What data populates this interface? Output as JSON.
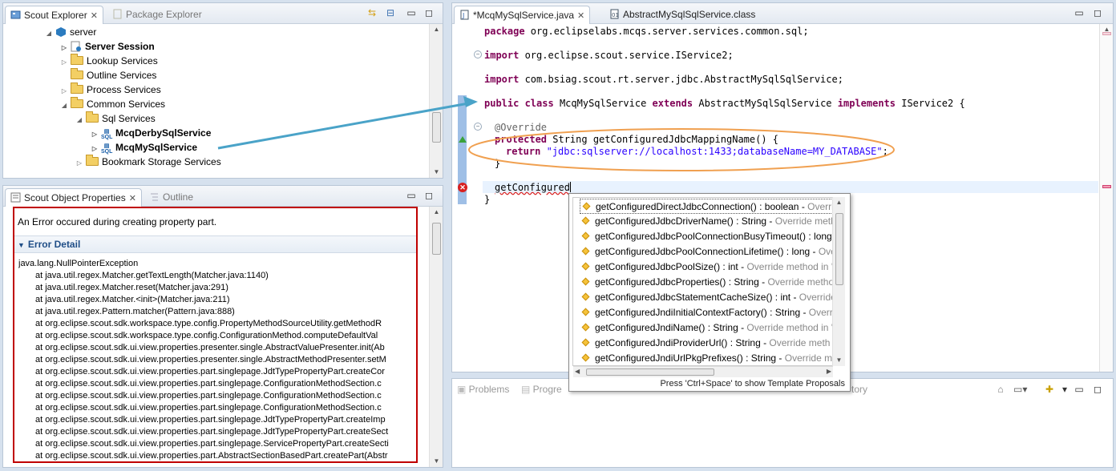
{
  "scout_explorer": {
    "tabs": [
      {
        "label": "Scout Explorer"
      },
      {
        "label": "Package Explorer"
      }
    ],
    "tree": [
      {
        "label": "server",
        "bold": false
      },
      {
        "label": "Server Session",
        "bold": true
      },
      {
        "label": "Lookup Services",
        "bold": false
      },
      {
        "label": "Outline Services",
        "bold": false
      },
      {
        "label": "Process Services",
        "bold": false
      },
      {
        "label": "Common Services",
        "bold": false
      },
      {
        "label": "Sql Services",
        "bold": false
      },
      {
        "label": "McqDerbySqlService",
        "bold": true
      },
      {
        "label": "McqMySqlService",
        "bold": true
      },
      {
        "label": "Bookmark Storage Services",
        "bold": false
      }
    ]
  },
  "properties": {
    "tabs": [
      {
        "label": "Scout Object Properties"
      },
      {
        "label": "Outline"
      }
    ],
    "error_message": "An Error occured during creating property part.",
    "section_title": "Error Detail",
    "stack": [
      "java.lang.NullPointerException",
      "at java.util.regex.Matcher.getTextLength(Matcher.java:1140)",
      "at java.util.regex.Matcher.reset(Matcher.java:291)",
      "at java.util.regex.Matcher.<init>(Matcher.java:211)",
      "at java.util.regex.Pattern.matcher(Pattern.java:888)",
      "at org.eclipse.scout.sdk.workspace.type.config.PropertyMethodSourceUtility.getMethodR",
      "at org.eclipse.scout.sdk.workspace.type.config.ConfigurationMethod.computeDefaultVal",
      "at org.eclipse.scout.sdk.ui.view.properties.presenter.single.AbstractValuePresenter.init(Ab",
      "at org.eclipse.scout.sdk.ui.view.properties.presenter.single.AbstractMethodPresenter.setM",
      "at org.eclipse.scout.sdk.ui.view.properties.part.singlepage.JdtTypePropertyPart.createCor",
      "at org.eclipse.scout.sdk.ui.view.properties.part.singlepage.ConfigurationMethodSection.c",
      "at org.eclipse.scout.sdk.ui.view.properties.part.singlepage.ConfigurationMethodSection.c",
      "at org.eclipse.scout.sdk.ui.view.properties.part.singlepage.ConfigurationMethodSection.c",
      "at org.eclipse.scout.sdk.ui.view.properties.part.singlepage.JdtTypePropertyPart.createImp",
      "at org.eclipse.scout.sdk.ui.view.properties.part.singlepage.JdtTypePropertyPart.createSect",
      "at org.eclipse.scout.sdk.ui.view.properties.part.singlepage.ServicePropertyPart.createSecti",
      "at org.eclipse.scout.sdk.ui.view.properties.part.AbstractSectionBasedPart.createPart(Abstr"
    ]
  },
  "editor": {
    "tabs": [
      {
        "label": "*McqMySqlService.java"
      },
      {
        "label": "AbstractMySqlSqlService.class"
      }
    ],
    "code": {
      "package_kw": "package",
      "package_rest": " org.eclipselabs.mcqs.server.services.common.sql;",
      "import_kw": "import",
      "import1_rest": " org.eclipse.scout.service.IService2;",
      "import2_rest": " com.bsiag.scout.rt.server.jdbc.AbstractMySqlSqlService;",
      "public_kw": "public",
      "class_kw": " class",
      "class_name": " McqMySqlService ",
      "extends_kw": "extends",
      "super_name": " AbstractMySqlSqlService ",
      "implements_kw": "implements",
      "iface_name": " IService2 {",
      "override": "@Override",
      "protected_kw": "protected",
      "method_sig": " String getConfiguredJdbcMappingName() {",
      "return_kw": "return",
      "return_str": "\"jdbc:sqlserver://localhost:1433;databaseName=MY_DATABASE\"",
      "return_end": ";",
      "close_brace_inner": "}",
      "typed": "getConfigured",
      "close_brace_outer": "}"
    }
  },
  "completion": {
    "items": [
      {
        "main": "getConfiguredDirectJdbcConnection() : boolean - ",
        "grey": "Overrid"
      },
      {
        "main": "getConfiguredJdbcDriverName() : String - ",
        "grey": "Override metho"
      },
      {
        "main": "getConfiguredJdbcPoolConnectionBusyTimeout() : long",
        "grey": ""
      },
      {
        "main": "getConfiguredJdbcPoolConnectionLifetime() : long - ",
        "grey": "Ove"
      },
      {
        "main": "getConfiguredJdbcPoolSize() : int - ",
        "grey": "Override method in 'A"
      },
      {
        "main": "getConfiguredJdbcProperties() : String - ",
        "grey": "Override method"
      },
      {
        "main": "getConfiguredJdbcStatementCacheSize() : int - ",
        "grey": "Override r"
      },
      {
        "main": "getConfiguredJndiInitialContextFactory() : String - ",
        "grey": "Overric"
      },
      {
        "main": "getConfiguredJndiName() : String - ",
        "grey": "Override method in 'A"
      },
      {
        "main": "getConfiguredJndiProviderUrl() : String - ",
        "grey": "Override meth"
      },
      {
        "main": "getConfiguredJndiUrlPkgPrefixes() : String - ",
        "grey": "Override met"
      }
    ],
    "hint": "Press 'Ctrl+Space' to show Template Proposals"
  },
  "bottom_tabs": [
    {
      "label": "Problems"
    },
    {
      "label": "Progre"
    },
    {
      "label": "tory"
    }
  ],
  "colors": {
    "error_border": "#c00000",
    "callout_ellipse": "#f0a050",
    "arrow": "#4aa3c8",
    "string": "#2a00ff",
    "keyword": "#7f0055"
  }
}
